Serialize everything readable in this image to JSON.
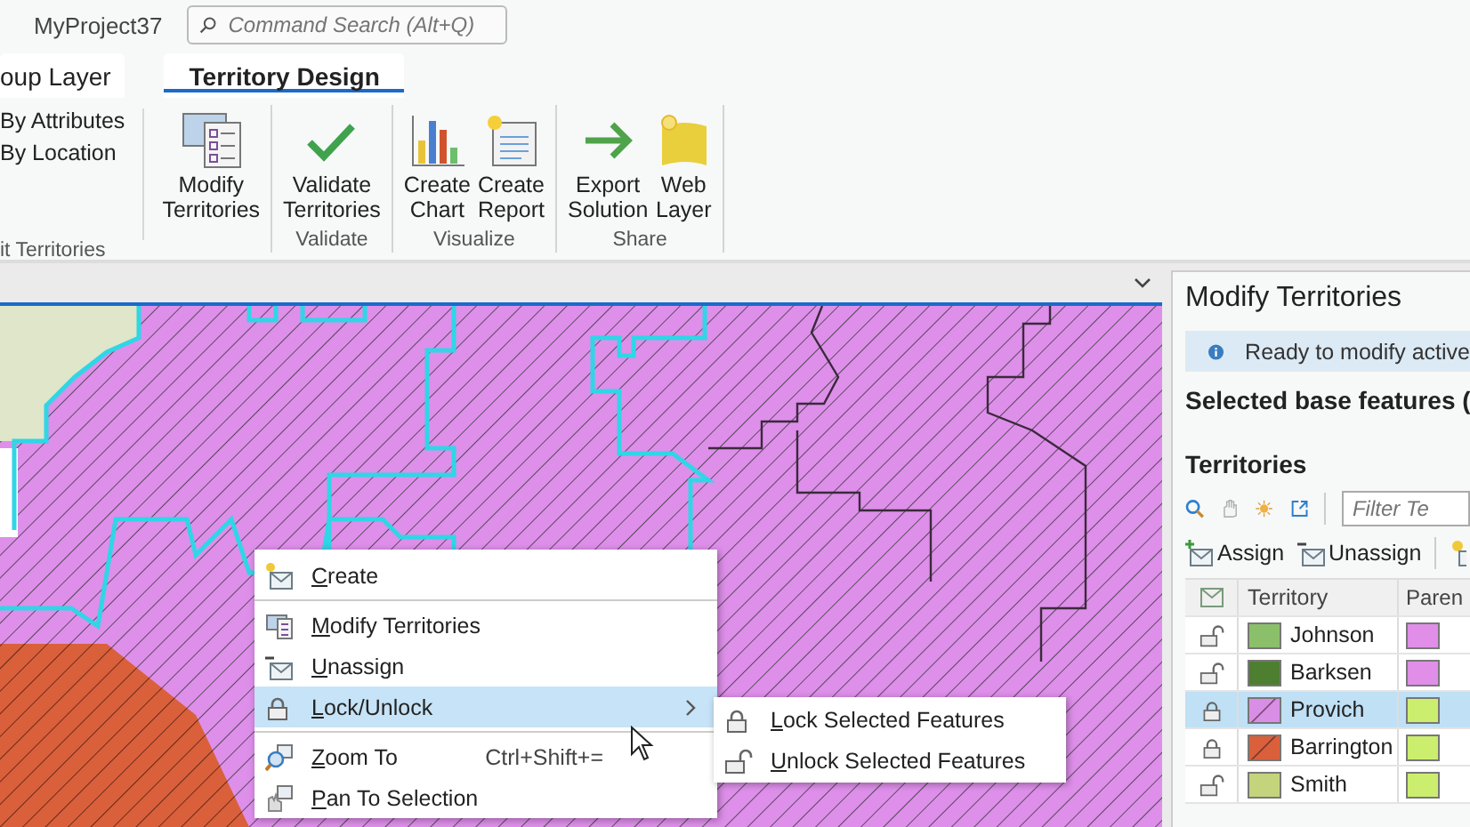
{
  "app_bar": {
    "project": "MyProject37",
    "search": {
      "placeholder": "Command Search (Alt+Q)"
    }
  },
  "tabs": [
    {
      "label": "oup Layer",
      "selected": false
    },
    {
      "label": "Territory Design",
      "selected": true
    }
  ],
  "ribbon": {
    "groups": [
      {
        "label": "it Territories",
        "small_buttons": [
          {
            "label": "By Attributes"
          },
          {
            "label": "By Location"
          }
        ],
        "buttons": [
          {
            "label": "Modify Territories"
          }
        ]
      },
      {
        "label": "Validate",
        "buttons": [
          {
            "label": "Validate Territories"
          }
        ]
      },
      {
        "label": "Visualize",
        "buttons": [
          {
            "label": "Create Chart"
          },
          {
            "label": "Create Report"
          }
        ]
      },
      {
        "label": "Share",
        "buttons": [
          {
            "label": "Export Solution"
          },
          {
            "label": "Web Layer"
          }
        ]
      }
    ]
  },
  "context_menu": {
    "items": [
      {
        "kind": "item",
        "label": "Create",
        "highlighted": false,
        "submenu": false
      },
      {
        "kind": "separator"
      },
      {
        "kind": "item",
        "label": "Modify Territories",
        "highlighted": false,
        "submenu": false
      },
      {
        "kind": "item",
        "label": "Unassign",
        "highlighted": false,
        "submenu": false
      },
      {
        "kind": "item",
        "label": "Lock/Unlock",
        "highlighted": true,
        "submenu": true
      },
      {
        "kind": "separator"
      },
      {
        "kind": "item",
        "label": "Zoom To",
        "shortcut": "Ctrl+Shift+=",
        "highlighted": false,
        "submenu": false
      },
      {
        "kind": "item",
        "label": "Pan To Selection",
        "highlighted": false,
        "submenu": false
      }
    ],
    "submenu": [
      {
        "label": "Lock Selected Features"
      },
      {
        "label": "Unlock Selected Features"
      }
    ]
  },
  "panel": {
    "title": "Modify Territories",
    "info": "Ready to modify active",
    "selected_heading": "Selected base features (",
    "territories_heading": "Territories",
    "filter": {
      "placeholder": "Filter Te"
    },
    "actions": [
      {
        "label": "Assign"
      },
      {
        "label": "Unassign"
      }
    ],
    "columns": [
      "Territory",
      "Paren"
    ],
    "rows": [
      {
        "locked": false,
        "selected": false,
        "name": "Johnson",
        "color": "#8cbf6a",
        "hatched": false,
        "parent": {
          "color": "#e08ee8"
        }
      },
      {
        "locked": false,
        "selected": false,
        "name": "Barksen",
        "color": "#4e7f30",
        "hatched": false,
        "parent": {
          "color": "#e08ee8"
        }
      },
      {
        "locked": true,
        "selected": true,
        "name": "Provich",
        "color": "#d98ee6",
        "hatched": true,
        "parent": {
          "color": "#ccee6e"
        }
      },
      {
        "locked": true,
        "selected": false,
        "name": "Barrington",
        "color": "#d9603b",
        "hatched": true,
        "parent": {
          "color": "#ccee6e"
        }
      },
      {
        "locked": false,
        "selected": false,
        "name": "Smith",
        "color": "#c4d47c",
        "hatched": false,
        "parent": {
          "color": "#ccee6e"
        }
      }
    ]
  }
}
